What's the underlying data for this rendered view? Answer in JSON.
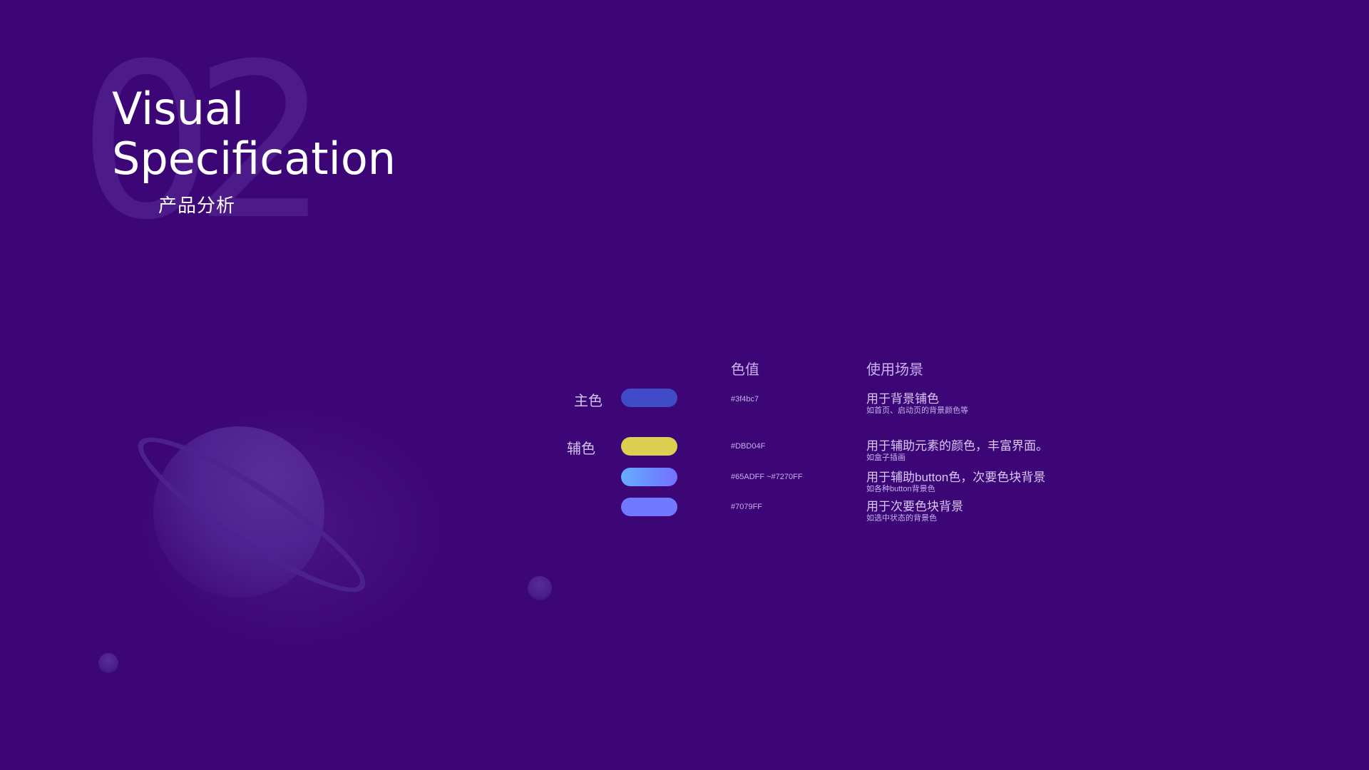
{
  "hero": {
    "number": "02",
    "title_line1": "Visual",
    "title_line2": "Specification",
    "subtitle": "产品分析"
  },
  "table": {
    "header_color": "色值",
    "header_usage": "使用场景",
    "groups": {
      "primary": "主色",
      "secondary": "辅色"
    },
    "rows": [
      {
        "hex": "#3f4bc7",
        "color": "#3f4bc7",
        "usage": "用于背景铺色",
        "note": "如首页、启动页的背景颜色等"
      },
      {
        "hex": "#DBD04F",
        "color": "#DBD04F",
        "usage": "用于辅助元素的颜色，丰富界面。",
        "note": "如盒子插画"
      },
      {
        "hex": "#65ADFF ~#7270FF",
        "color_from": "#65ADFF",
        "color_to": "#7270FF",
        "usage": "用于辅助button色，次要色块背景",
        "note": "如各种button背景色"
      },
      {
        "hex": "#7079FF",
        "color": "#7079FF",
        "usage": "用于次要色块背景",
        "note": "如选中状态的背景色"
      }
    ]
  },
  "background_color": "#3c0677"
}
